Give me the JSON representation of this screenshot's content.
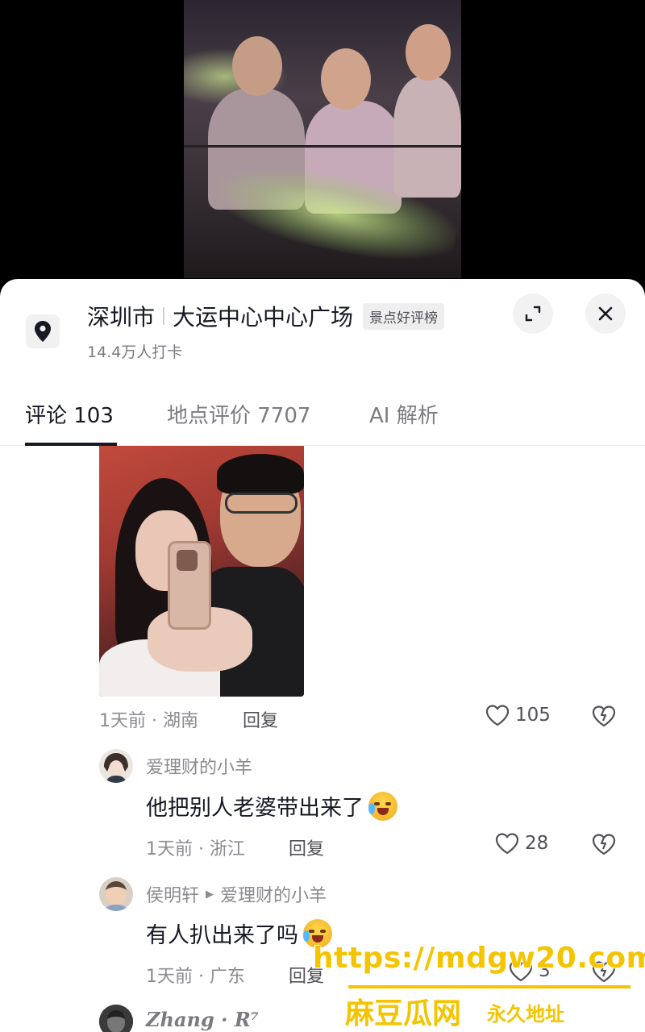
{
  "location": {
    "city": "深圳市",
    "place": "大运中心中心广场",
    "badge": "景点好评榜",
    "checkins": "14.4万人打卡"
  },
  "tabs": [
    {
      "label": "评论 103",
      "active": true
    },
    {
      "label": "地点评价 7707",
      "active": false
    },
    {
      "label": "AI 解析",
      "active": false
    }
  ],
  "comments": [
    {
      "time": "1天前 · 湖南",
      "reply_label": "回复",
      "likes": "105",
      "has_image": true
    },
    {
      "user": "爱理财的小羊",
      "text": "他把别人老婆带出来了",
      "emoji": "crying-laughing-emoji",
      "time": "1天前 · 浙江",
      "reply_label": "回复",
      "likes": "28"
    },
    {
      "user": "侯明轩",
      "reply_to": "爱理财的小羊",
      "text": "有人扒出来了吗",
      "emoji": "crying-emoji",
      "time": "1天前 · 广东",
      "reply_label": "回复",
      "likes": "3"
    },
    {
      "user": "Zhang · R⁷"
    }
  ],
  "watermark": {
    "url": "https://mdgw20.com",
    "brand": "麻豆瓜网",
    "slogan": "永久地址"
  },
  "colors": {
    "text_primary": "#161823",
    "text_secondary": "#8a8b8f",
    "watermark": "#f5c400"
  }
}
